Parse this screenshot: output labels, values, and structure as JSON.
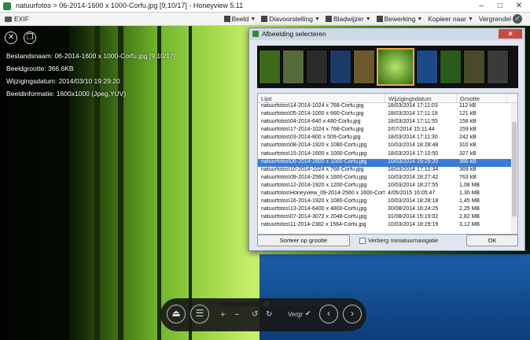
{
  "window": {
    "title": "natuurfotos > 06-2014-1600 x 1000-Corfu.jpg [9,10/17] - Honeyview 5.11",
    "minimize": "–",
    "maximize": "□",
    "close": "✕"
  },
  "menubar": {
    "exif": "EXIF",
    "items": [
      "Beeld",
      "Diavoorstelling",
      "Bladwijzer",
      "Bewerking",
      "Kopieer naar",
      "Vergrendel"
    ]
  },
  "info": {
    "file_label": "Bestandsnaam:",
    "file_value": "06-2014-1600 x 1000-Corfu.jpg [9,10/17]",
    "size_label": "Beeldgrootte:",
    "size_value": "366.6KB",
    "date_label": "Wijzigingsdatum:",
    "date_value": "2014/03/10 19:29:20",
    "imginfo_label": "Beeldinformatie:",
    "imginfo_value": "1600x1000 (Jpeg,YUV)"
  },
  "dialog": {
    "title": "Afbeelding selecteren",
    "close": "✕",
    "columns": [
      "Lijst",
      "Wijzigingsdatum",
      "Grootte"
    ],
    "rows": [
      [
        "natuurfotos\\14-2014-1024 x 768-Corfu.jpg",
        "18/03/2014 17:11:03",
        "112 kB"
      ],
      [
        "natuurfotos\\05-2014-1000 x 660-Corfu.jpg",
        "18/03/2014 17:11:18",
        "121 kB"
      ],
      [
        "natuurfotos\\04-2014-640 x 480-Corfu.jpg",
        "18/03/2014 17:11:55",
        "158 kB"
      ],
      [
        "natuurfotos\\17-2014-1024 x 768-Corfu.jpg",
        "2/07/2014 15:11:44",
        "159 kB"
      ],
      [
        "natuurfotos\\03-2014-800 x 509-Corfu.jpg",
        "18/03/2014 17:11:30",
        "242 kB"
      ],
      [
        "natuurfotos\\08-2014-1920 x 1080-Corfu.jpg",
        "10/03/2014 18:28:48",
        "310 kB"
      ],
      [
        "natuurfotos\\15-2014-1600 x 1000-Corfu.jpg",
        "18/03/2014 17:10:50",
        "327 kB"
      ],
      [
        "natuurfotos\\06-2014-1600 x 1000-Corfu.jpg",
        "10/03/2014 19:29:20",
        "366 kB"
      ],
      [
        "natuurfotos\\10-2014-1024 x 768-Corfu.jpg",
        "18/03/2014 17:12:34",
        "369 kB"
      ],
      [
        "natuurfotos\\09-2014-2560 x 1600-Corfu.jpg",
        "10/03/2014 18:27:42",
        "763 kB"
      ],
      [
        "natuurfotos\\12-2014-1920 x 1200-Corfu.jpg",
        "10/03/2014 18:27:55",
        "1,08 MB"
      ],
      [
        "natuurfotos\\Honeyview_09-2014-2560 x 1600-Corf...",
        "4/05/2015 16:05:47",
        "1,30 MB"
      ],
      [
        "natuurfotos\\16-2014-1920 x 1080-Corfu.jpg",
        "10/03/2014 18:28:18",
        "1,45 MB"
      ],
      [
        "natuurfotos\\13-2014-6400 x 4800-Corfu.jpg",
        "30/08/2014 16:24:25",
        "2,25 MB"
      ],
      [
        "natuurfotos\\07-2014-3072 x 2048-Corfu.jpg",
        "31/08/2014 15:19:02",
        "2,82 MB"
      ],
      [
        "natuurfotos\\11-2014-2382 x 1564-Corfu.jpg",
        "10/03/2014 18:29:19",
        "3,12 MB"
      ]
    ],
    "selected_index": 7,
    "sort_button": "Sorteer op grootte",
    "hide_checkbox": "Verberg miniatuurnavigatie",
    "ok_button": "OK"
  },
  "toolbar": {
    "zoom_in": "+",
    "zoom_out": "−",
    "fit_label": "Vergr",
    "prev": "‹",
    "next": "›",
    "progress": 0.45
  }
}
